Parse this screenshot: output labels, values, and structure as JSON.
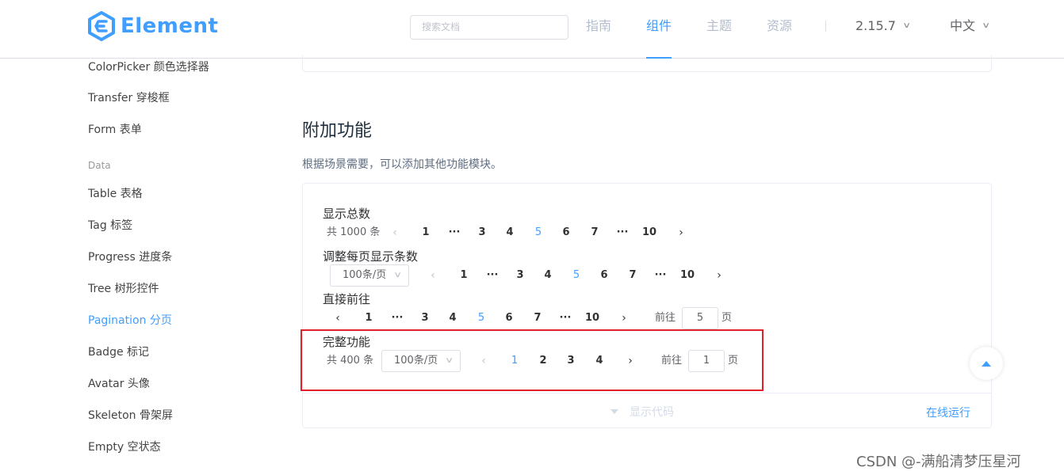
{
  "header": {
    "logo_text": "Element",
    "search_placeholder": "搜索文档",
    "nav": [
      "指南",
      "组件",
      "主题",
      "资源"
    ],
    "active_nav": "组件",
    "version": "2.15.7",
    "language": "中文"
  },
  "colors": {
    "brand": "#409eff",
    "highlight_box": "#e0202b"
  },
  "sidebar": {
    "items": [
      {
        "label": "ColorPicker 颜色选择器"
      },
      {
        "label": "Transfer 穿梭框"
      },
      {
        "label": "Form 表单"
      },
      {
        "label": "Table 表格"
      },
      {
        "label": "Tag 标签"
      },
      {
        "label": "Progress 进度条"
      },
      {
        "label": "Tree 树形控件"
      },
      {
        "label": "Pagination 分页"
      },
      {
        "label": "Badge 标记"
      },
      {
        "label": "Avatar 头像"
      },
      {
        "label": "Skeleton 骨架屏"
      },
      {
        "label": "Empty 空状态"
      }
    ],
    "group_data": "Data",
    "active_item": "Pagination 分页"
  },
  "main": {
    "section_title": "附加功能",
    "section_desc": "根据场景需要，可以添加其他功能模块。",
    "blocks": {
      "total": {
        "title": "显示总数",
        "total_text": "共 1000 条",
        "pages": [
          "1",
          "···",
          "3",
          "4",
          "5",
          "6",
          "7",
          "···",
          "10"
        ],
        "current": "5"
      },
      "sizes": {
        "title": "调整每页显示条数",
        "size_value": "100条/页",
        "pages": [
          "1",
          "···",
          "3",
          "4",
          "5",
          "6",
          "7",
          "···",
          "10"
        ],
        "current": "5"
      },
      "jumper": {
        "title": "直接前往",
        "pages": [
          "1",
          "···",
          "3",
          "4",
          "5",
          "6",
          "7",
          "···",
          "10"
        ],
        "current": "5",
        "goto_label": "前往",
        "goto_value": "5",
        "page_suffix": "页"
      },
      "full": {
        "title": "完整功能",
        "total_text": "共 400 条",
        "size_value": "100条/页",
        "pages": [
          "1",
          "2",
          "3",
          "4"
        ],
        "current": "1",
        "goto_label": "前往",
        "goto_value": "1",
        "page_suffix": "页"
      }
    },
    "show_code": "显示代码",
    "run_online": "在线运行"
  },
  "watermark": "CSDN @-满船清梦压星河"
}
